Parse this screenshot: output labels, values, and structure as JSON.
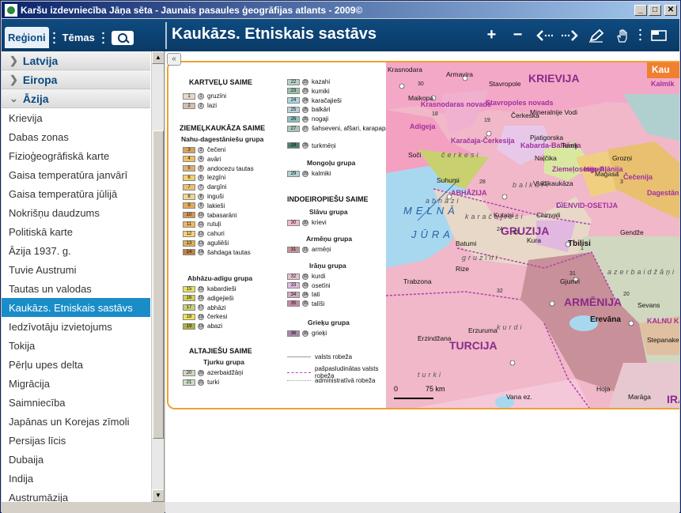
{
  "window": {
    "title": "Karšu izdevniecība Jāņa sēta - Jaunais pasaules ģeogrāfijas atlants - 2009©"
  },
  "toolbar": {
    "tabs": [
      {
        "label": "Reģioni"
      },
      {
        "label": "Tēmas"
      }
    ],
    "page_title": "Kaukāzs. Etniskais sastāvs"
  },
  "sidebar": {
    "categories": [
      {
        "label": "Latvija",
        "state": "collapsed"
      },
      {
        "label": "Eiropa",
        "state": "collapsed"
      },
      {
        "label": "Āzija",
        "state": "expanded"
      }
    ],
    "items": [
      {
        "label": "Krievija"
      },
      {
        "label": "Dabas zonas"
      },
      {
        "label": "Fizioģeogrāfiskā karte"
      },
      {
        "label": "Gaisa temperatūra janvārī"
      },
      {
        "label": "Gaisa temperatūra jūlijā"
      },
      {
        "label": "Nokrišņu daudzums"
      },
      {
        "label": "Politiskā karte"
      },
      {
        "label": "Āzija 1937. g."
      },
      {
        "label": "Tuvie Austrumi"
      },
      {
        "label": "Tautas un valodas"
      },
      {
        "label": "Kaukāzs. Etniskais sastāvs",
        "selected": true
      },
      {
        "label": "Iedzīvotāju izvietojums"
      },
      {
        "label": "Tokija"
      },
      {
        "label": "Pērļu upes delta"
      },
      {
        "label": "Migrācija"
      },
      {
        "label": "Saimniecība"
      },
      {
        "label": "Japānas un Korejas zīmoli"
      },
      {
        "label": "Persijas līcis"
      },
      {
        "label": "Dubaija"
      },
      {
        "label": "Indija"
      },
      {
        "label": "Austrumāzija"
      }
    ]
  },
  "legend": {
    "kartvelu": {
      "title": "KARTVEĻU SAIME",
      "entries": [
        {
          "n": "1",
          "name": "gruzīni",
          "color": "#e8d8c8"
        },
        {
          "n": "2",
          "name": "lazi",
          "color": "#d0c0b0"
        }
      ]
    },
    "ziemelkaukaza": {
      "title": "ZIEMEĻKAUKĀZA SAIME",
      "group": "Nahu-dagestāniešu grupa",
      "entries": [
        {
          "n": "3",
          "name": "čečeni",
          "color": "#d8a060"
        },
        {
          "n": "4",
          "name": "avāri",
          "color": "#f0c060"
        },
        {
          "n": "5",
          "name": "andocezu tautas",
          "color": "#e0b070"
        },
        {
          "n": "6",
          "name": "lezgīni",
          "color": "#f4d070"
        },
        {
          "n": "7",
          "name": "dargīni",
          "color": "#e8c070"
        },
        {
          "n": "8",
          "name": "inguši",
          "color": "#f0d890"
        },
        {
          "n": "9",
          "name": "lakieši",
          "color": "#e8a858"
        },
        {
          "n": "10",
          "name": "tabasarāni",
          "color": "#d89850"
        },
        {
          "n": "11",
          "name": "rutuļi",
          "color": "#f0b860"
        },
        {
          "n": "12",
          "name": "cahuri",
          "color": "#f8d070"
        },
        {
          "n": "13",
          "name": "aguliēši",
          "color": "#e0b050"
        },
        {
          "n": "14",
          "name": "šahdaga tautas",
          "color": "#c08040"
        }
      ],
      "group2": "Abhāzu-adigu grupa",
      "entries2": [
        {
          "n": "15",
          "name": "kabardieši",
          "color": "#e8e060"
        },
        {
          "n": "16",
          "name": "adigejieši",
          "color": "#d0d050"
        },
        {
          "n": "17",
          "name": "abhāzi",
          "color": "#c8d070"
        },
        {
          "n": "18",
          "name": "čerkesi",
          "color": "#f0e050"
        },
        {
          "n": "19",
          "name": "abazi",
          "color": "#b0b040"
        }
      ]
    },
    "altajiesu": {
      "title": "ALTAJIEŠU SAIME",
      "group": "Tjurku grupa",
      "entries": [
        {
          "n": "20",
          "name": "azerbaidžāņi",
          "color": "#d0d8c0"
        },
        {
          "n": "21",
          "name": "turki",
          "color": "#c8e0c0"
        }
      ],
      "entries2": [
        {
          "n": "22",
          "name": "kazahi",
          "color": "#b8d0c8"
        },
        {
          "n": "23",
          "name": "kumiki",
          "color": "#98c0a8"
        },
        {
          "n": "24",
          "name": "karačajieši",
          "color": "#a8d8e0"
        },
        {
          "n": "25",
          "name": "balkāri",
          "color": "#b8d0d8"
        },
        {
          "n": "26",
          "name": "nogaji",
          "color": "#90c0c0"
        },
        {
          "n": "27",
          "name": "šahseveni, afšari, karapapahi",
          "color": "#a8c8b8"
        },
        {
          "n": "28",
          "name": "turkmēņi",
          "color": "#4a8070"
        }
      ]
    },
    "mongolu": {
      "group": "Mongoļu grupa",
      "entries": [
        {
          "n": "29",
          "name": "kalmiki",
          "color": "#b0d0d0"
        }
      ]
    },
    "indoeiropiesu": {
      "title": "INDOEIROPIEŠU SAIME",
      "slavu": {
        "group": "Slāvu grupa",
        "entries": [
          {
            "n": "30",
            "name": "krievi",
            "color": "#f0b8c8"
          }
        ]
      },
      "armenu": {
        "group": "Armēņu grupa",
        "entries": [
          {
            "n": "31",
            "name": "armēņi",
            "color": "#c89098"
          }
        ]
      },
      "iranu": {
        "group": "Irāņu grupa",
        "entries": [
          {
            "n": "32",
            "name": "kurdi",
            "color": "#e8c0d0"
          },
          {
            "n": "33",
            "name": "osetīni",
            "color": "#e0b8e0"
          },
          {
            "n": "34",
            "name": "tati",
            "color": "#d0a8c0"
          },
          {
            "n": "35",
            "name": "talīši",
            "color": "#c888a8"
          }
        ]
      },
      "grieku": {
        "group": "Grieķu grupa",
        "entries": [
          {
            "n": "36",
            "name": "grieķi",
            "color": "#a888a8"
          }
        ]
      }
    },
    "lines": [
      {
        "name": "valsts robeža"
      },
      {
        "name": "pašpasludinātas valsts robeža"
      },
      {
        "name": "administratīvā robeža"
      }
    ]
  },
  "map": {
    "regions": [
      {
        "name": "KRIEVIJA"
      },
      {
        "name": "GRUZIJA"
      },
      {
        "name": "ARMĒNIJA"
      },
      {
        "name": "TURCIJA"
      },
      {
        "name": "IRĀN"
      },
      {
        "name": "Kau"
      }
    ],
    "sub_regions": [
      {
        "name": "Krasnodaras novads"
      },
      {
        "name": "Stavropoles novads"
      },
      {
        "name": "Adigeja"
      },
      {
        "name": "Karačaja-Čerkesija"
      },
      {
        "name": "Kabarda-Balkārija"
      },
      {
        "name": "Ziemeļosetija-Alānija"
      },
      {
        "name": "Ingušija"
      },
      {
        "name": "Čečenija"
      },
      {
        "name": "Dagestān"
      },
      {
        "name": "Kalmik"
      },
      {
        "name": "ABHĀZIJA"
      },
      {
        "name": "DIENVID-OSETIJA"
      },
      {
        "name": "KALNU KARABAHA"
      }
    ],
    "cities": [
      {
        "name": "Krasnodara"
      },
      {
        "name": "Armavira"
      },
      {
        "name": "Stavropole"
      },
      {
        "name": "Maikopa"
      },
      {
        "name": "Čerkeska"
      },
      {
        "name": "Mineralnije Vodi"
      },
      {
        "name": "Pjatigorska"
      },
      {
        "name": "Soči"
      },
      {
        "name": "Naļčika"
      },
      {
        "name": "Vladikaukāza"
      },
      {
        "name": "Magasa"
      },
      {
        "name": "Grozņi"
      },
      {
        "name": "Suhumi"
      },
      {
        "name": "Kutaisi"
      },
      {
        "name": "Chinvali"
      },
      {
        "name": "Batumi"
      },
      {
        "name": "Tbilisi"
      },
      {
        "name": "Rize"
      },
      {
        "name": "Trabzona"
      },
      {
        "name": "Gjumri"
      },
      {
        "name": "Erevāna"
      },
      {
        "name": "Gendže"
      },
      {
        "name": "Stepanakert"
      },
      {
        "name": "Erzuruma"
      },
      {
        "name": "Erzindžana"
      },
      {
        "name": "Vana ez."
      },
      {
        "name": "Hoja"
      },
      {
        "name": "Marāga"
      },
      {
        "name": "Sevans"
      },
      {
        "name": "Terek"
      },
      {
        "name": "Kura"
      }
    ],
    "sea": [
      "MELNĀ",
      "JŪRA"
    ],
    "scale": {
      "zero": "0",
      "value": "75 km"
    },
    "ethnic_labels": [
      "gruzīni",
      "čerkesi",
      "abhāzi",
      "karačajieši",
      "balkāri",
      "azerbaidžāņi",
      "kurdi",
      "turki"
    ],
    "numbers": [
      "30",
      "18",
      "19",
      "3",
      "28",
      "21",
      "24",
      "33",
      "1",
      "32",
      "20",
      "31"
    ]
  },
  "colors": {
    "toolbar": "#0a3a66",
    "accent": "#1a8dc8",
    "frame": "#f0a030",
    "sea": "#a8d8f0",
    "russia": "#f0a8c8",
    "georgia": "#e8d8c8",
    "armenia": "#c89098",
    "turkey": "#f0b8c8"
  },
  "icons": {
    "zoom_in": "plus-icon",
    "zoom_out": "minus-icon",
    "back": "back-icon",
    "forward": "forward-icon",
    "draw": "pencil-icon",
    "pan": "hand-icon",
    "fullscreen": "window-icon"
  }
}
